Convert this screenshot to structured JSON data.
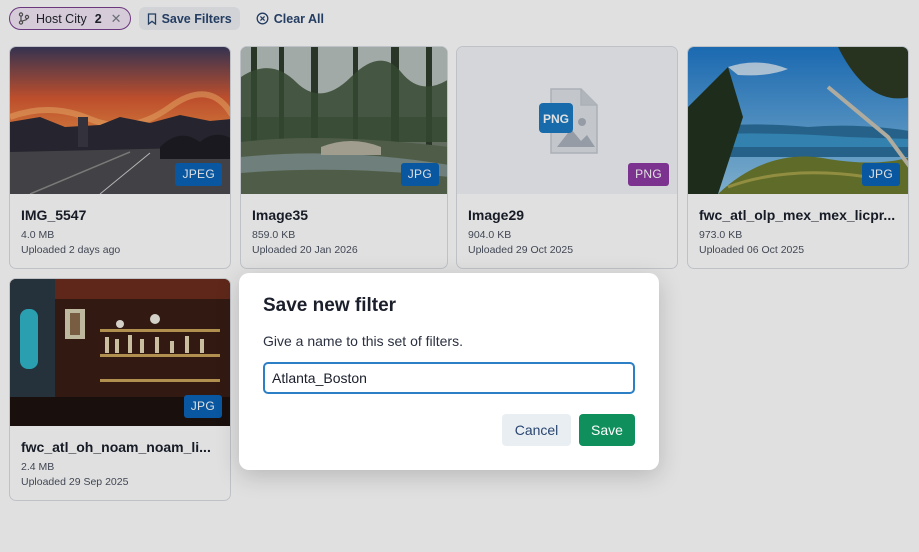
{
  "toolbar": {
    "filter_chip": {
      "label": "Host City",
      "count": "2",
      "icon": "branch-icon",
      "remove_icon": "close-icon"
    },
    "save_filters": {
      "label": "Save Filters",
      "icon": "bookmark-icon"
    },
    "clear_all": {
      "label": "Clear All",
      "icon": "circle-x-icon"
    }
  },
  "cards": [
    {
      "title": "IMG_5547",
      "size": "4.0 MB",
      "uploaded": "Uploaded 2 days ago",
      "format": "JPEG",
      "format_color": "#0b63b8",
      "image": "sunset-street-photo"
    },
    {
      "title": "Image35",
      "size": "859.0 KB",
      "uploaded": "Uploaded 20 Jan 2026",
      "format": "JPG",
      "format_color": "#0b63b8",
      "image": "forest-stream-photo"
    },
    {
      "title": "Image29",
      "size": "904.0 KB",
      "uploaded": "Uploaded 29 Oct 2025",
      "format": "PNG",
      "format_color": "#8e3aa3",
      "image": "png-file-placeholder-icon",
      "placeholder_label": "PNG"
    },
    {
      "title": "fwc_atl_olp_mex_mex_licpr...",
      "size": "973.0 KB",
      "uploaded": "Uploaded 06 Oct 2025",
      "format": "JPG",
      "format_color": "#0b63b8",
      "image": "crater-lake-photo"
    },
    {
      "title": "fwc_atl_oh_noam_noam_li...",
      "size": "2.4 MB",
      "uploaded": "Uploaded 29 Sep 2025",
      "format": "JPG",
      "format_color": "#0b63b8",
      "image": "bar-interior-photo"
    }
  ],
  "dialog": {
    "title": "Save new filter",
    "description": "Give a name to this set of filters.",
    "input_value": "Atlanta_Boston",
    "cancel_label": "Cancel",
    "save_label": "Save",
    "save_color": "#0f8f5c"
  }
}
